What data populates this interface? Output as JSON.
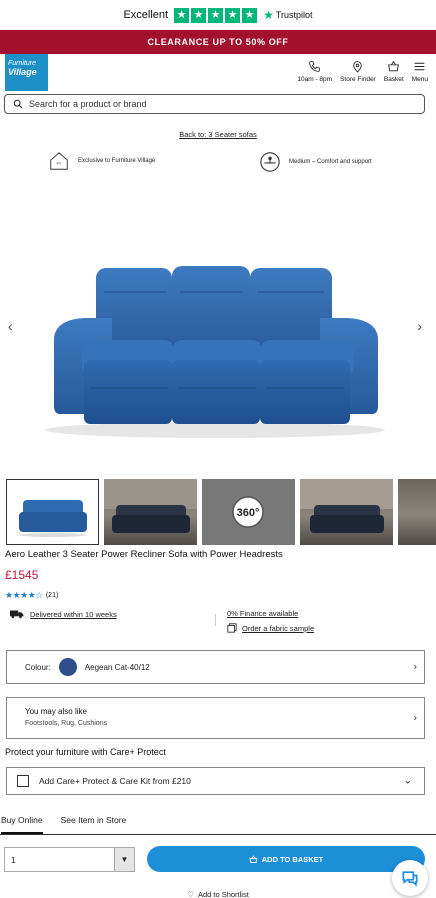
{
  "trustpilot": {
    "rating_word": "Excellent",
    "brand": "Trustpilot",
    "stars": 5
  },
  "promo": {
    "text": "CLEARANCE UP TO 50% OFF"
  },
  "header": {
    "logo_line1": "Furniture",
    "logo_line2": "Village",
    "actions": [
      {
        "icon": "phone-icon",
        "label": "10am - 8pm"
      },
      {
        "icon": "location-pin-icon",
        "label": "Store Finder"
      },
      {
        "icon": "basket-icon",
        "label": "Basket"
      },
      {
        "icon": "hamburger-menu-icon",
        "label": "Menu"
      }
    ]
  },
  "search": {
    "placeholder": "Search for a product or brand"
  },
  "breadcrumb": {
    "back_link": "Back to: 3 Seater sofas"
  },
  "features": [
    {
      "icon": "house-icon",
      "label": "Exclusive to Furniture Village"
    },
    {
      "icon": "comfort-scale-icon",
      "label": "Medium – Comfort and support"
    }
  ],
  "product": {
    "title": "Aero Leather 3 Seater Power Recliner Sofa with Power Headrests",
    "price": "£1545",
    "rating_count": "(21)",
    "rating_value": 4.5,
    "delivery": "Delivered within 10 weeks",
    "finance": "0% Finance available",
    "fabric_sample": "Order a fabric sample",
    "sofa_color": "#2f6bb0"
  },
  "gallery": {
    "prev": "‹",
    "next": "›",
    "badge_360": "360°"
  },
  "colour": {
    "label": "Colour:",
    "value": "Aegean Cat-40/12",
    "swatch": "#2e4f8a"
  },
  "also_like": {
    "heading": "You may also like",
    "items": "Footstools, Rug, Cushions"
  },
  "protect": {
    "heading": "Protect your furniture with Care+ Protect",
    "option": "Add Care+ Protect & Care Kit from £210"
  },
  "tabs": [
    {
      "label": "Buy Online",
      "active": true
    },
    {
      "label": "See Item in Store",
      "active": false
    }
  ],
  "purchase": {
    "quantity": "1",
    "add_to_basket": "ADD TO BASKET"
  },
  "shortlist": {
    "label": "Add to Shortlist"
  },
  "colors": {
    "promo_bg": "#a3102c",
    "accent": "#1d8ed8",
    "price": "#c0123c",
    "trustpilot": "#00b67a"
  }
}
